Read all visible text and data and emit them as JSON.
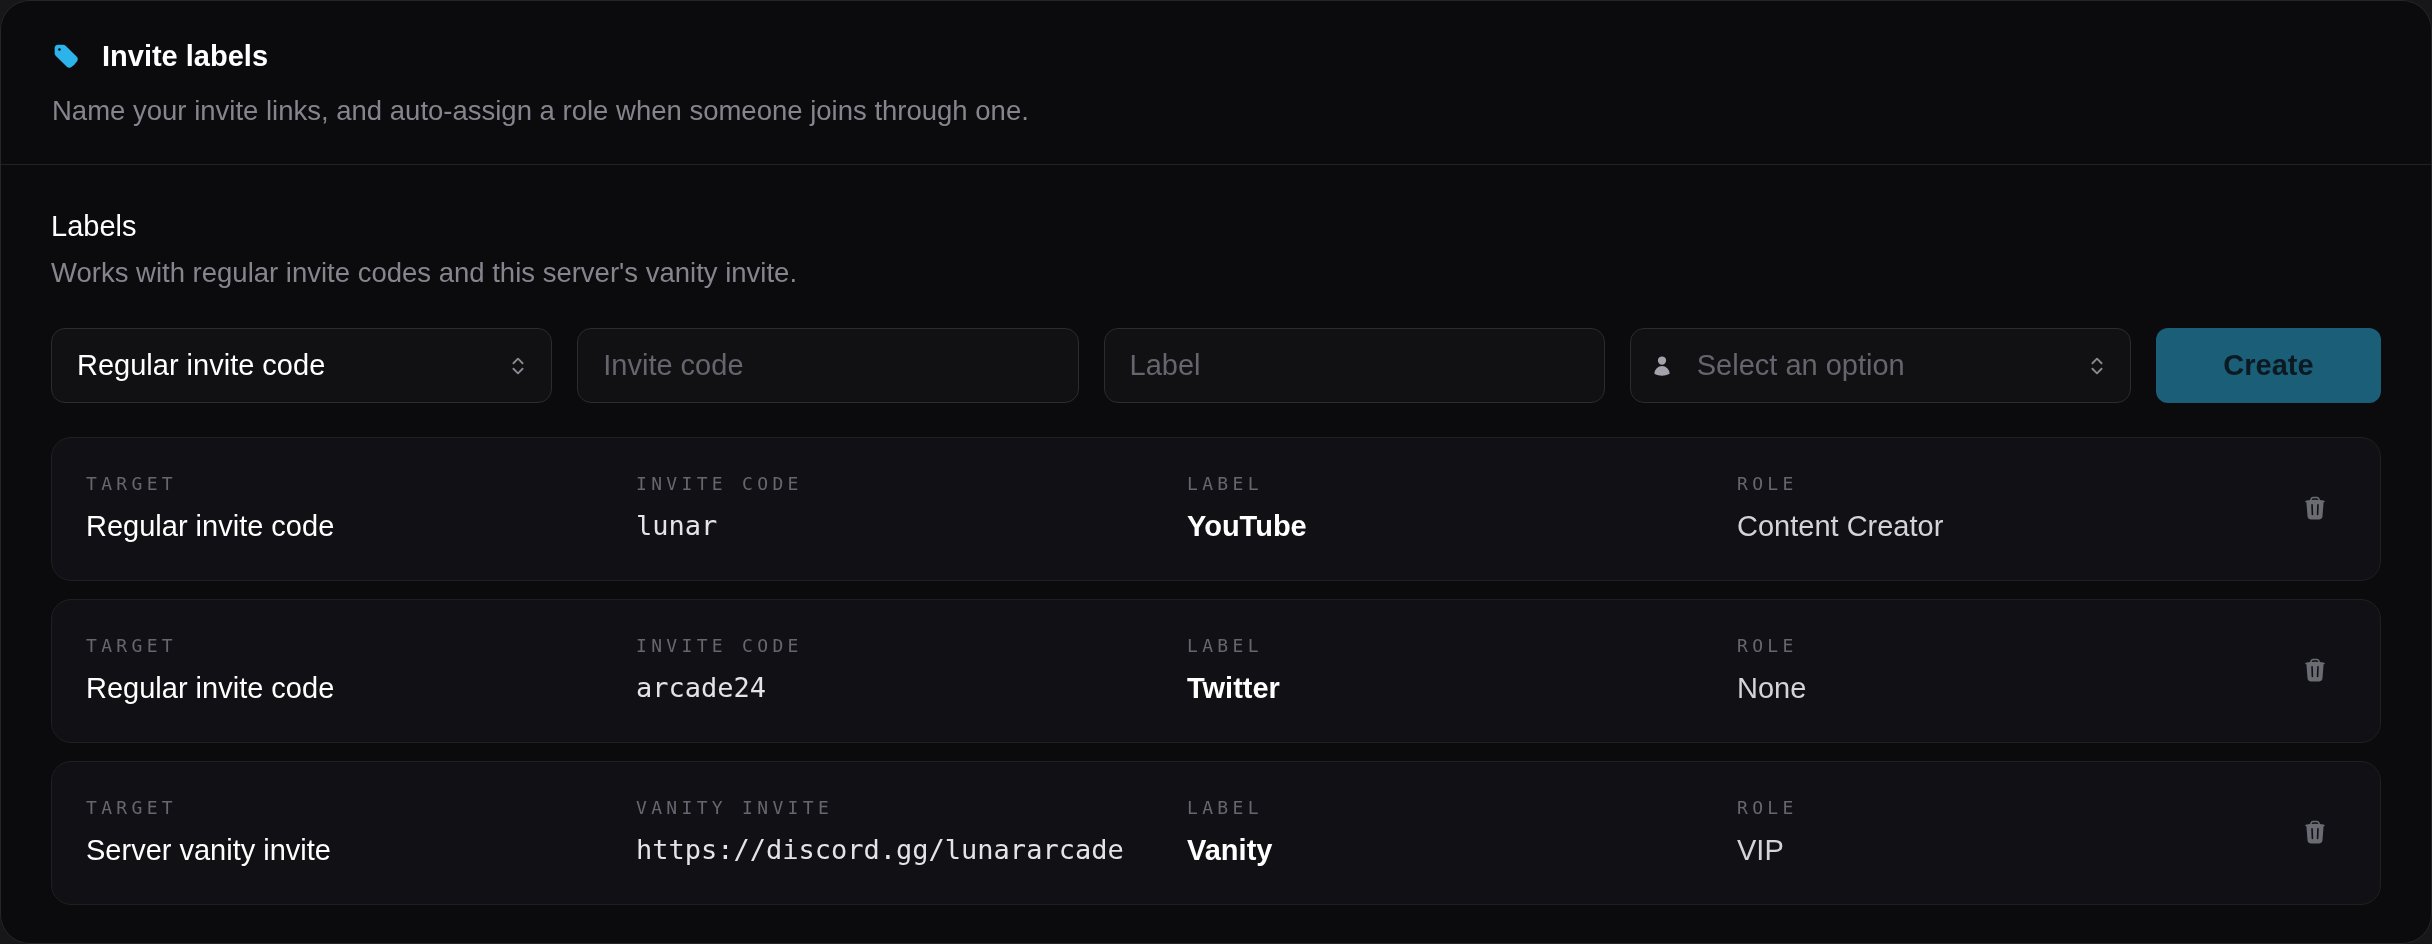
{
  "header": {
    "title": "Invite labels",
    "description": "Name your invite links, and auto-assign a role when someone joins through one."
  },
  "section": {
    "title": "Labels",
    "description": "Works with regular invite codes and this server's vanity invite."
  },
  "form": {
    "target_select": {
      "value": "Regular invite code"
    },
    "invite_code": {
      "placeholder": "Invite code"
    },
    "label": {
      "placeholder": "Label"
    },
    "role_select": {
      "placeholder": "Select an option"
    },
    "create_button": "Create"
  },
  "rows": [
    {
      "target": {
        "heading": "TARGET",
        "value": "Regular invite code"
      },
      "code": {
        "heading": "INVITE CODE",
        "value": "lunar"
      },
      "label": {
        "heading": "LABEL",
        "value": "YouTube"
      },
      "role": {
        "heading": "ROLE",
        "value": "Content Creator"
      }
    },
    {
      "target": {
        "heading": "TARGET",
        "value": "Regular invite code"
      },
      "code": {
        "heading": "INVITE CODE",
        "value": "arcade24"
      },
      "label": {
        "heading": "LABEL",
        "value": "Twitter"
      },
      "role": {
        "heading": "ROLE",
        "value": "None"
      }
    },
    {
      "target": {
        "heading": "TARGET",
        "value": "Server vanity invite"
      },
      "code": {
        "heading": "VANITY INVITE",
        "value": "https://discord.gg/lunararcade"
      },
      "label": {
        "heading": "LABEL",
        "value": "Vanity"
      },
      "role": {
        "heading": "ROLE",
        "value": "VIP"
      }
    }
  ]
}
